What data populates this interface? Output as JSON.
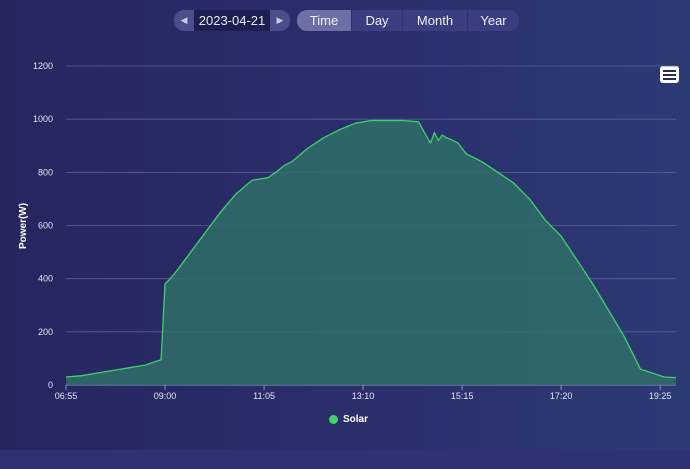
{
  "date_picker": {
    "prev_icon": "step-back-icon",
    "date": "2023-04-21",
    "next_icon": "step-forward-icon"
  },
  "tabs": [
    {
      "label": "Time",
      "active": true
    },
    {
      "label": "Day",
      "active": false
    },
    {
      "label": "Month",
      "active": false
    },
    {
      "label": "Year",
      "active": false
    }
  ],
  "menu_icon": "hamburger-menu-icon",
  "chart_data": {
    "type": "area",
    "ylabel": "Power(W)",
    "xlabel": "",
    "ylim": [
      0,
      1200
    ],
    "yticks": [
      0,
      200,
      400,
      600,
      800,
      1000,
      1200
    ],
    "xtick_labels": [
      "06:55",
      "09:00",
      "11:05",
      "13:10",
      "15:15",
      "17:20",
      "19:25"
    ],
    "grid": true,
    "legend": "bottom-center",
    "series": [
      {
        "name": "Solar",
        "color": "#3fd16a",
        "fill": "#2f6e68",
        "x": [
          "06:55",
          "07:15",
          "07:35",
          "07:55",
          "08:15",
          "08:35",
          "08:45",
          "08:55",
          "09:00",
          "09:05",
          "09:15",
          "09:30",
          "09:50",
          "10:10",
          "10:30",
          "10:50",
          "11:10",
          "11:20",
          "11:30",
          "11:40",
          "12:00",
          "12:20",
          "12:40",
          "13:00",
          "13:20",
          "13:40",
          "14:00",
          "14:20",
          "14:35",
          "14:40",
          "14:45",
          "14:50",
          "14:55",
          "15:00",
          "15:10",
          "15:20",
          "15:40",
          "16:00",
          "16:20",
          "16:40",
          "17:00",
          "17:20",
          "17:40",
          "18:00",
          "18:20",
          "18:40",
          "19:00",
          "19:20",
          "19:30",
          "19:45"
        ],
        "y": [
          30,
          35,
          45,
          55,
          65,
          75,
          85,
          95,
          380,
          395,
          430,
          490,
          570,
          650,
          720,
          770,
          780,
          800,
          825,
          840,
          890,
          930,
          960,
          985,
          995,
          995,
          995,
          990,
          910,
          950,
          920,
          940,
          930,
          925,
          910,
          870,
          840,
          800,
          760,
          700,
          620,
          560,
          470,
          380,
          280,
          180,
          60,
          40,
          30,
          28
        ]
      }
    ]
  }
}
